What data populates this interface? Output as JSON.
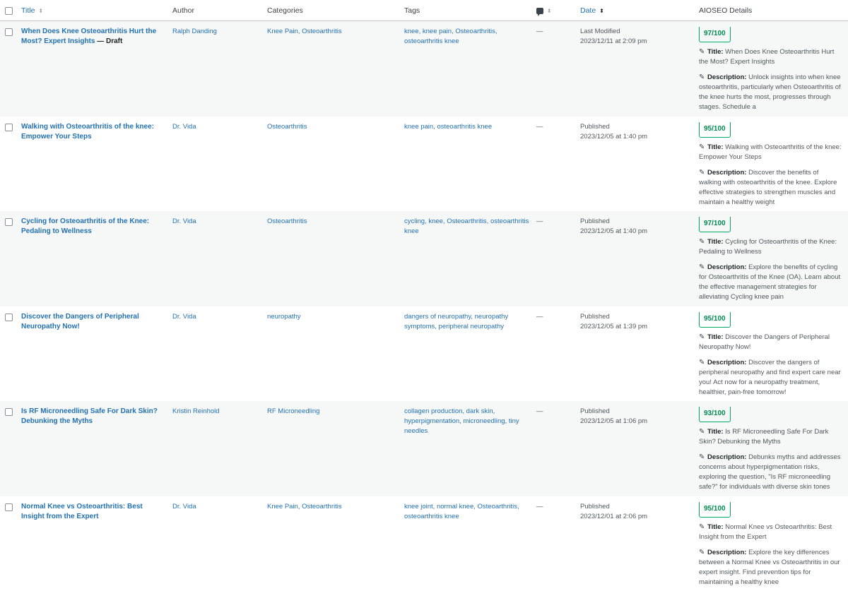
{
  "header": {
    "title": "Title",
    "author": "Author",
    "categories": "Categories",
    "tags": "Tags",
    "date": "Date",
    "aioseo": "AIOSEO Details"
  },
  "labels": {
    "title_prefix": "Title:",
    "description_prefix": "Description:"
  },
  "rows": [
    {
      "title": "When Does Knee Osteoarthritis Hurt the Most? Expert Insights",
      "state": " — Draft",
      "author": "Ralph Danding",
      "categories": "Knee Pain, Osteoarthritis",
      "tags": "knee, knee pain, Osteoarthritis, osteoarthritis knee",
      "comments": "—",
      "date_status": "Last Modified",
      "date_value": "2023/12/11 at 2:09 pm",
      "score": "97/100",
      "seo_title": "When Does Knee Osteoarthritis Hurt the Most? Expert Insights",
      "seo_description": "Unlock insights into when knee osteoarthritis, particularly when Osteoarthritis of the knee hurts the most, progresses through stages. Schedule a"
    },
    {
      "title": "Walking with Osteoarthritis of the knee: Empower Your Steps",
      "state": "",
      "author": "Dr. Vida",
      "categories": "Osteoarthritis",
      "tags": "knee pain, osteoarthritis knee",
      "comments": "—",
      "date_status": "Published",
      "date_value": "2023/12/05 at 1:40 pm",
      "score": "95/100",
      "seo_title": "Walking with Osteoarthritis of the knee: Empower Your Steps",
      "seo_description": "Discover the benefits of walking with osteoarthritis of the knee. Explore effective strategies to strengthen muscles and maintain a healthy weight"
    },
    {
      "title": "Cycling for Osteoarthritis of the Knee: Pedaling to Wellness",
      "state": "",
      "author": "Dr. Vida",
      "categories": "Osteoarthritis",
      "tags": "cycling, knee, Osteoarthritis, osteoarthritis knee",
      "comments": "—",
      "date_status": "Published",
      "date_value": "2023/12/05 at 1:40 pm",
      "score": "97/100",
      "seo_title": "Cycling for Osteoarthritis of the Knee: Pedaling to Wellness",
      "seo_description": "Explore the benefits of cycling for Osteoarthritis of the Knee (OA). Learn about the effective management strategies for alleviating Cycling knee pain"
    },
    {
      "title": "Discover the Dangers of Peripheral Neuropathy Now!",
      "state": "",
      "author": "Dr. Vida",
      "categories": "neuropathy",
      "tags": "dangers of neuropathy, neuropathy symptoms, peripheral neuropathy",
      "comments": "—",
      "date_status": "Published",
      "date_value": "2023/12/05 at 1:39 pm",
      "score": "95/100",
      "seo_title": "Discover the Dangers of Peripheral Neuropathy Now!",
      "seo_description": "Discover the dangers of peripheral neuropathy and find expert care near you! Act now for a neuropathy treatment, healthier, pain-free tomorrow!"
    },
    {
      "title": "Is RF Microneedling Safe For Dark Skin? Debunking the Myths",
      "state": "",
      "author": "Kristin Reinhold",
      "categories": "RF Microneedling",
      "tags": "collagen production, dark skin, hyperpigmentation, microneedling, tiny needles",
      "comments": "—",
      "date_status": "Published",
      "date_value": "2023/12/05 at 1:06 pm",
      "score": "93/100",
      "seo_title": "Is RF Microneedling Safe For Dark Skin? Debunking the Myths",
      "seo_description": "Debunks myths and addresses concerns about hyperpigmentation risks, exploring the question, \"Is RF microneedling safe?\" for individuals with diverse skin tones"
    },
    {
      "title": "Normal Knee vs Osteoarthritis: Best Insight from the Expert",
      "state": "",
      "author": "Dr. Vida",
      "categories": "Knee Pain, Osteoarthritis",
      "tags": "knee joint, normal knee, Osteoarthritis, osteoarthritis knee",
      "comments": "—",
      "date_status": "Published",
      "date_value": "2023/12/01 at 2:06 pm",
      "score": "95/100",
      "seo_title": "Normal Knee vs Osteoarthritis: Best Insight from the Expert",
      "seo_description": "Explore the key differences between a Normal Knee vs Osteoarthritis in our expert insight. Find prevention tips for maintaining a healthy knee"
    }
  ]
}
